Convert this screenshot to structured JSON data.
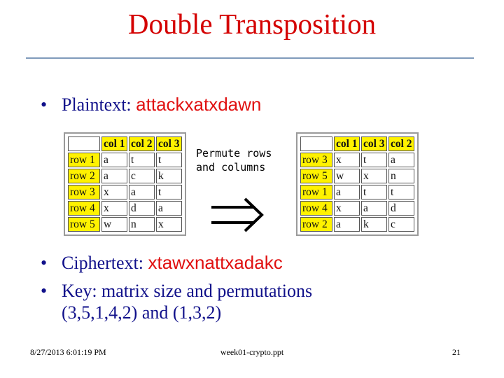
{
  "slide": {
    "title": "Double Transposition",
    "bullets": {
      "plaintext_label": "Plaintext:",
      "plaintext_value": "attackxatxdawn",
      "ciphertext_label": "Ciphertext:",
      "ciphertext_value": "xtawxnattxadakc",
      "key_line1": "Key: matrix size and permutations",
      "key_line2": "(3,5,1,4,2) and (1,3,2)"
    },
    "bullet_symbol": "•",
    "caption_line1": "Permute rows",
    "caption_line2": "and columns",
    "arrow_icon": "double-right-arrow",
    "table_before": {
      "headers": [
        "col 1",
        "col 2",
        "col 3"
      ],
      "rows": [
        {
          "label": "row 1",
          "cells": [
            "a",
            "t",
            "t"
          ]
        },
        {
          "label": "row 2",
          "cells": [
            "a",
            "c",
            "k"
          ]
        },
        {
          "label": "row 3",
          "cells": [
            "x",
            "a",
            "t"
          ]
        },
        {
          "label": "row 4",
          "cells": [
            "x",
            "d",
            "a"
          ]
        },
        {
          "label": "row 5",
          "cells": [
            "w",
            "n",
            "x"
          ]
        }
      ]
    },
    "table_after": {
      "headers": [
        "col 1",
        "col 3",
        "col 2"
      ],
      "rows": [
        {
          "label": "row 3",
          "cells": [
            "x",
            "t",
            "a"
          ]
        },
        {
          "label": "row 5",
          "cells": [
            "w",
            "x",
            "n"
          ]
        },
        {
          "label": "row 1",
          "cells": [
            "a",
            "t",
            "t"
          ]
        },
        {
          "label": "row 4",
          "cells": [
            "x",
            "a",
            "d"
          ]
        },
        {
          "label": "row 2",
          "cells": [
            "a",
            "k",
            "c"
          ]
        }
      ]
    },
    "colors": {
      "title": "#d40000",
      "body_text": "#10108a",
      "highlight_text": "#e01010",
      "table_header": "#fff200",
      "rule": "#7f9bbb"
    }
  },
  "footer": {
    "date": "8/27/2013 6:01:19 PM",
    "filename": "week01-crypto.ppt",
    "page_number": "21"
  }
}
